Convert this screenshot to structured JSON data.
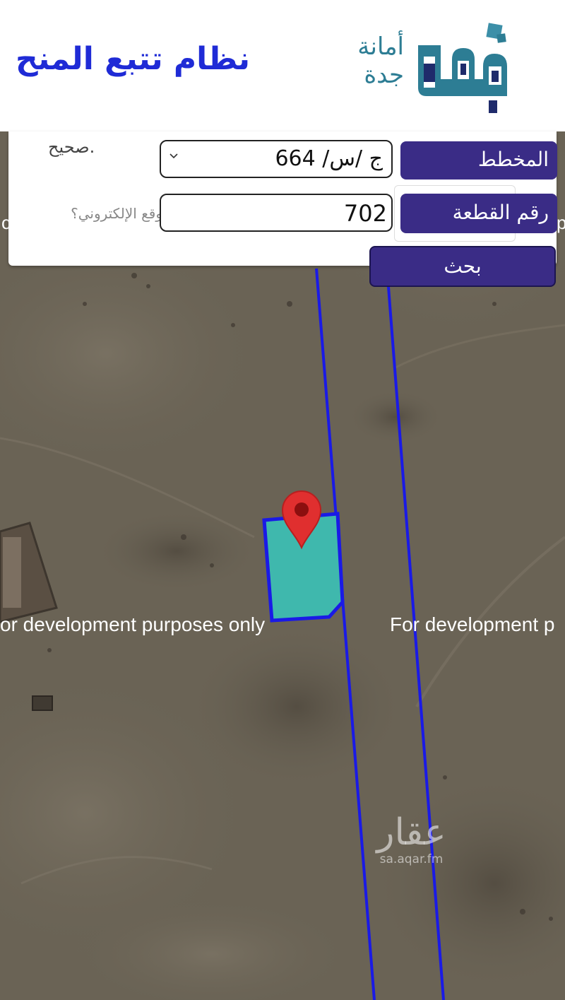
{
  "header": {
    "title": "نظام تتبع المنح",
    "logo_line1": "أمانة",
    "logo_line2": "جدة",
    "logo_icon": "jeddah-municipality-logo-icon"
  },
  "search": {
    "hint_top": "صحيح.",
    "hint_mid": "وقع الإلكتروني؟",
    "plan_label": "المخطط",
    "plan_value": "ج /س/ 664",
    "plot_label": "رقم القطعة",
    "plot_value": "702",
    "search_button": "بحث",
    "dropdown_icon": "chevron-down-icon"
  },
  "map": {
    "watermark_text": "For development purposes only",
    "watermark_left": "or development purposes only",
    "watermark_right": "For development p",
    "edge_left": "c",
    "edge_right": "p",
    "marker_icon": "map-pin-icon",
    "parcel_color": "#3fb8ad",
    "boundary_color": "#1a1ae6",
    "brand_watermark": "عقار",
    "brand_domain": "sa.aqar.fm"
  }
}
